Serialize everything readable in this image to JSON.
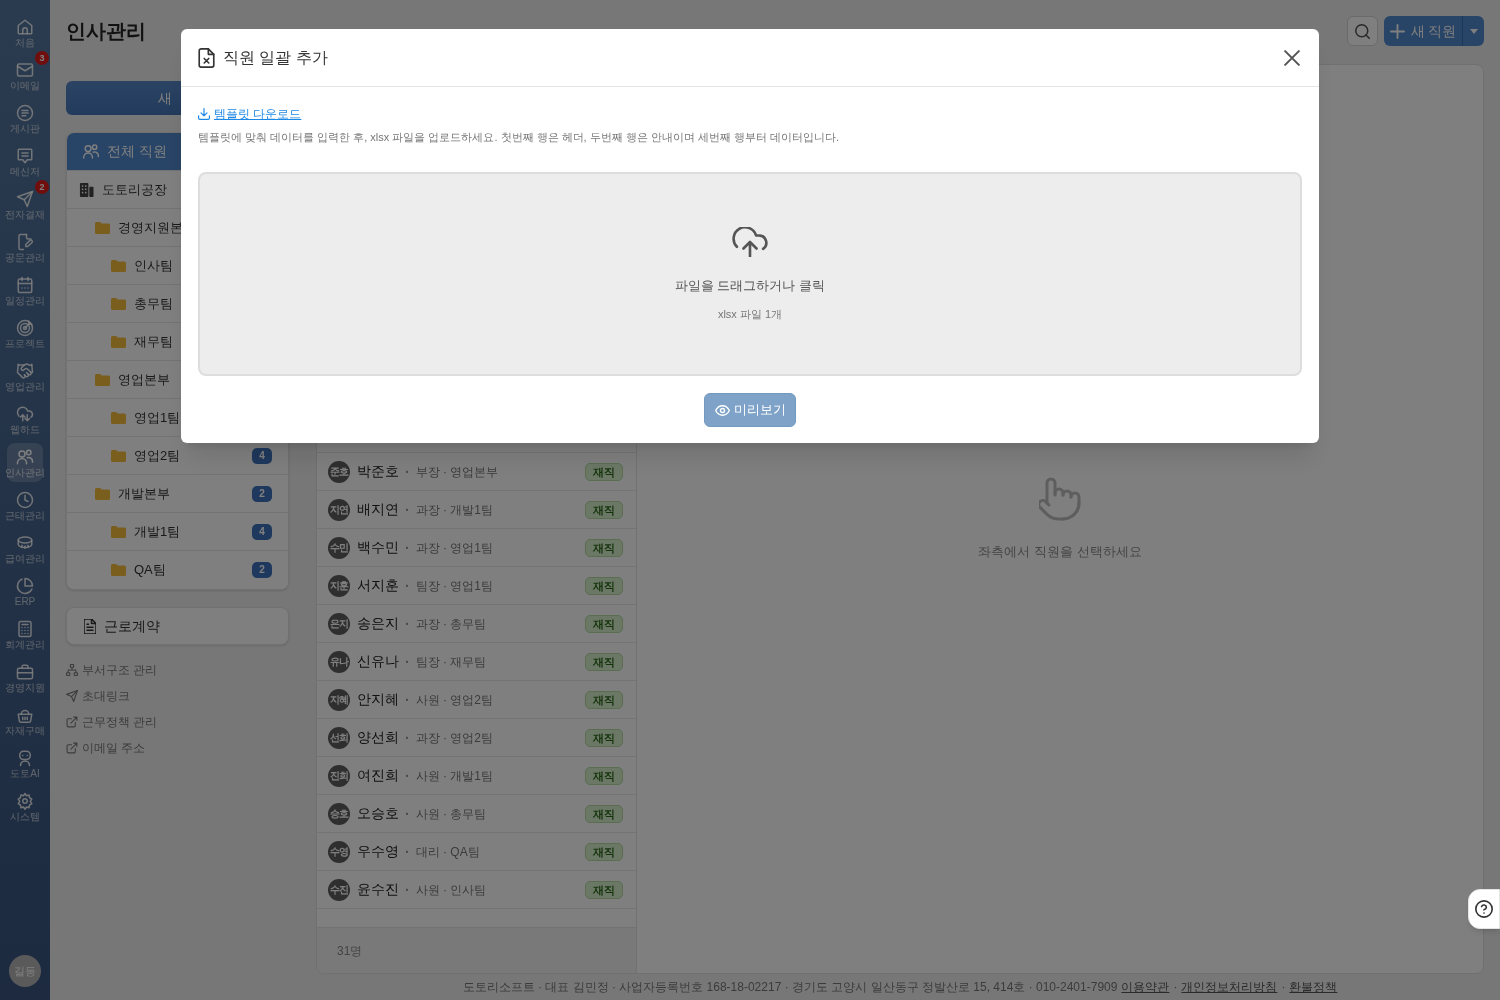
{
  "nav": {
    "items": [
      {
        "label": "처음",
        "selected": false
      },
      {
        "label": "이메일",
        "selected": false,
        "badge": "3"
      },
      {
        "label": "게시판",
        "selected": false
      },
      {
        "label": "메신저",
        "selected": false
      },
      {
        "label": "전자결재",
        "selected": false,
        "badge": "2"
      },
      {
        "label": "공문관리",
        "selected": false
      },
      {
        "label": "일정관리",
        "selected": false
      },
      {
        "label": "프로젝트",
        "selected": false
      },
      {
        "label": "영업관리",
        "selected": false
      },
      {
        "label": "웹하드",
        "selected": false
      },
      {
        "label": "인사관리",
        "selected": true
      },
      {
        "label": "근태관리",
        "selected": false
      },
      {
        "label": "급여관리",
        "selected": false
      },
      {
        "label": "ERP",
        "selected": false
      },
      {
        "label": "회계관리",
        "selected": false
      },
      {
        "label": "경영지원",
        "selected": false
      },
      {
        "label": "자재구매",
        "selected": false
      },
      {
        "label": "도토AI",
        "selected": false
      },
      {
        "label": "시스템",
        "selected": false
      }
    ],
    "user_avatar": "길동"
  },
  "sidebar": {
    "title": "인사관리",
    "new_button": "새",
    "tree": [
      {
        "kind": "all",
        "label": "전체 직원",
        "selected": true
      },
      {
        "kind": "company",
        "label": "도토리공장",
        "selected": false,
        "children": [
          {
            "kind": "department",
            "label": "경영지원본",
            "selected": false,
            "children": [
              {
                "kind": "department",
                "label": "인사팀",
                "selected": false
              },
              {
                "kind": "department",
                "label": "총무팀",
                "selected": false
              },
              {
                "kind": "department",
                "label": "재무팀",
                "selected": false
              }
            ]
          },
          {
            "kind": "department",
            "label": "영업본부",
            "selected": false,
            "children": [
              {
                "kind": "department",
                "label": "영업1팀",
                "selected": false
              },
              {
                "kind": "department",
                "label": "영업2팀",
                "selected": false,
                "badge": "4"
              }
            ]
          },
          {
            "kind": "department",
            "label": "개발본부",
            "selected": false,
            "badge": "2",
            "children": [
              {
                "kind": "department",
                "label": "개발1팀",
                "selected": false,
                "badge": "4"
              },
              {
                "kind": "department",
                "label": "QA팀",
                "selected": false,
                "badge": "2"
              }
            ]
          }
        ]
      }
    ],
    "contract_button": "근로계약",
    "links": [
      {
        "label": "부서구조 관리"
      },
      {
        "label": "초대링크"
      },
      {
        "label": "근무정책 관리"
      },
      {
        "label": "이메일 주소"
      }
    ]
  },
  "toolbar": {
    "new_employee_button": "새 직원"
  },
  "employee_list": {
    "rows": [
      {
        "initials": "준호",
        "name": "박준호",
        "separator": "·",
        "position": "부장 · 영업본부",
        "status": "재직"
      },
      {
        "initials": "지연",
        "name": "배지연",
        "separator": "·",
        "position": "과장 · 개발1팀",
        "status": "재직"
      },
      {
        "initials": "수민",
        "name": "백수민",
        "separator": "·",
        "position": "과장 · 영업1팀",
        "status": "재직"
      },
      {
        "initials": "지훈",
        "name": "서지훈",
        "separator": "·",
        "position": "팀장 · 영업1팀",
        "status": "재직"
      },
      {
        "initials": "은지",
        "name": "송은지",
        "separator": "·",
        "position": "과장 · 총무팀",
        "status": "재직"
      },
      {
        "initials": "유나",
        "name": "신유나",
        "separator": "·",
        "position": "팀장 · 재무팀",
        "status": "재직"
      },
      {
        "initials": "지혜",
        "name": "안지혜",
        "separator": "·",
        "position": "사원 · 영업2팀",
        "status": "재직"
      },
      {
        "initials": "선희",
        "name": "양선희",
        "separator": "·",
        "position": "과장 · 영업2팀",
        "status": "재직"
      },
      {
        "initials": "진희",
        "name": "여진희",
        "separator": "·",
        "position": "사원 · 개발1팀",
        "status": "재직"
      },
      {
        "initials": "승호",
        "name": "오승호",
        "separator": "·",
        "position": "사원 · 총무팀",
        "status": "재직"
      },
      {
        "initials": "수영",
        "name": "우수영",
        "separator": "·",
        "position": "대리 · QA팀",
        "status": "재직"
      },
      {
        "initials": "수진",
        "name": "윤수진",
        "separator": "·",
        "position": "사원 · 인사팀",
        "status": "재직"
      }
    ],
    "count": "31명"
  },
  "detail": {
    "empty_message": "좌측에서 직원을 선택하세요"
  },
  "modal": {
    "title": "직원 일괄 추가",
    "template_link": "템플릿 다운로드",
    "description": "템플릿에 맞춰 데이터를 입력한 후, xlsx 파일을 업로드하세요. 첫번째 행은 헤더, 두번째 행은 안내이며 세번째 행부터 데이터입니다.",
    "dropzone": {
      "prompt": "파일을 드래그하거나 클릭",
      "hint": "xlsx 파일 1개"
    },
    "preview_button": {
      "label": "미리보기",
      "disabled": true
    }
  },
  "footer": {
    "parts": [
      {
        "kind": "text",
        "text": "도토리소프트 · 대표 김민정 · 사업자등록번호 168-18-02217 · 경기도 고양시 일산동구 정발산로 15, 414호 · 010-2401-7909"
      },
      {
        "kind": "link",
        "text": "이용약관"
      },
      {
        "kind": "text",
        "text": "·"
      },
      {
        "kind": "link",
        "text": "개인정보처리방침"
      },
      {
        "kind": "text",
        "text": "·"
      },
      {
        "kind": "link",
        "text": "환불정책"
      }
    ]
  }
}
